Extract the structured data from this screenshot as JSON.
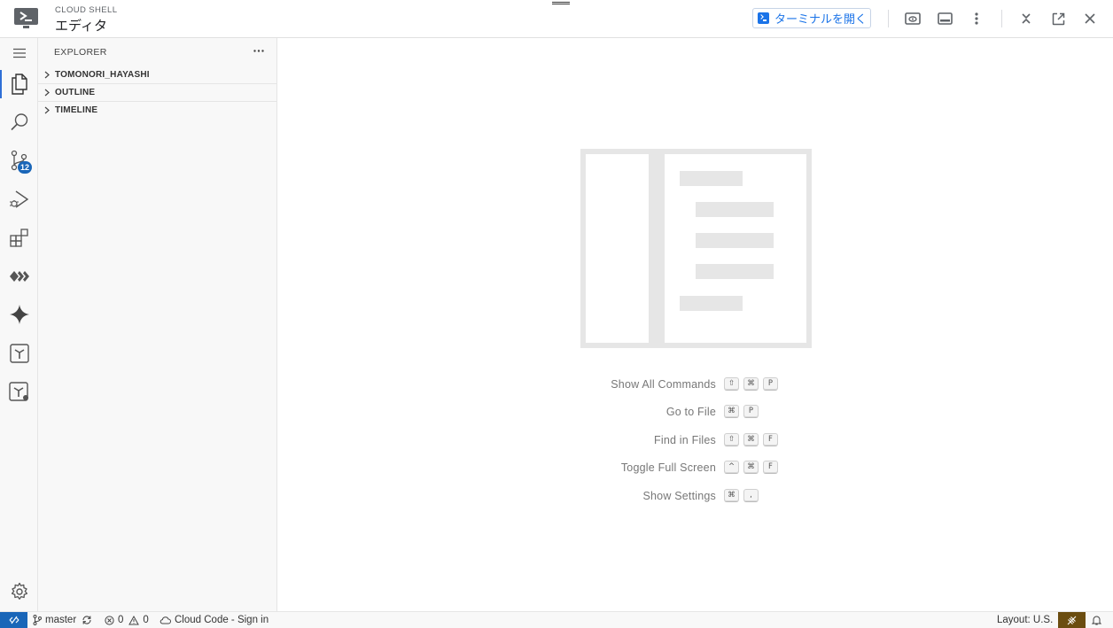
{
  "header": {
    "product_label": "CLOUD SHELL",
    "title": "エディタ",
    "open_terminal_label": "ターミナルを開く",
    "icons": [
      "preview-icon",
      "panel-icon",
      "more-vert-icon",
      "minimize-icon",
      "open-new-window-icon",
      "close-icon"
    ]
  },
  "activity_bar": {
    "items": [
      "menu-icon",
      "explorer-icon",
      "search-icon",
      "source-control-icon",
      "run-debug-icon",
      "extensions-icon",
      "cloud-code-icon",
      "gemini-icon",
      "terraform-icon",
      "terraform-cloud-icon",
      "settings-gear-icon"
    ],
    "source_control_badge": "12",
    "active": "explorer-icon"
  },
  "sidebar": {
    "title": "EXPLORER",
    "sections": [
      {
        "label": "TOMONORI_HAYASHI"
      },
      {
        "label": "OUTLINE"
      },
      {
        "label": "TIMELINE"
      }
    ]
  },
  "editor": {
    "shortcuts": [
      {
        "label": "Show All Commands",
        "keys": [
          "⇧",
          "⌘",
          "P"
        ]
      },
      {
        "label": "Go to File",
        "keys": [
          "⌘",
          "P"
        ]
      },
      {
        "label": "Find in Files",
        "keys": [
          "⇧",
          "⌘",
          "F"
        ]
      },
      {
        "label": "Toggle Full Screen",
        "keys": [
          "^",
          "⌘",
          "F"
        ]
      },
      {
        "label": "Show Settings",
        "keys": [
          "⌘",
          ","
        ]
      }
    ]
  },
  "status_bar": {
    "branch": "master",
    "errors": "0",
    "warnings": "0",
    "cloud_code": "Cloud Code - Sign in",
    "layout": "Layout: U.S.",
    "colors": {
      "remote": "#1a66b8",
      "warning_box": "#6b4d10"
    }
  },
  "colors": {
    "accent": "#1a73e8",
    "badge": "#1a66b8"
  }
}
